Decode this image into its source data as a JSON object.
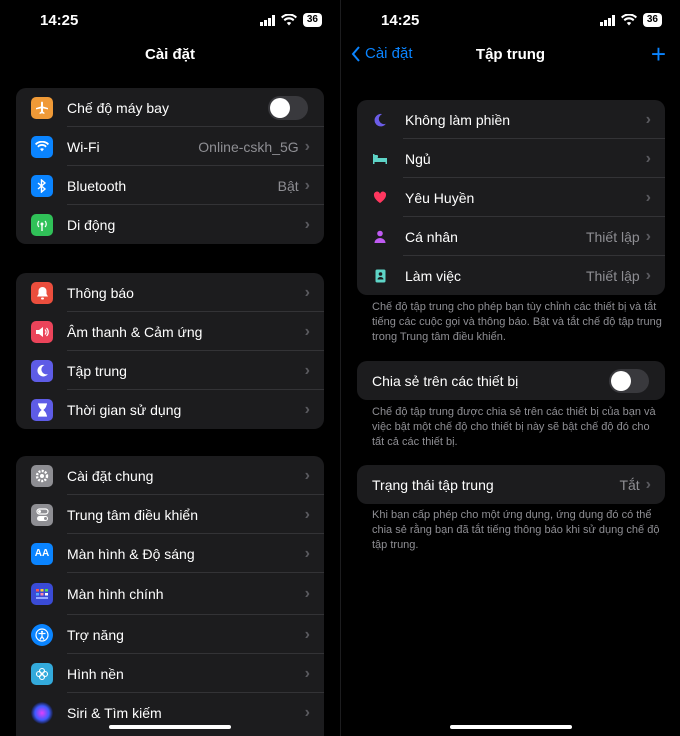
{
  "left": {
    "status": {
      "time": "14:25",
      "battery": "36"
    },
    "title": "Cài đặt",
    "group1": [
      {
        "label": "Chế độ máy bay",
        "toggle": false,
        "color": "#f09a37"
      },
      {
        "label": "Wi-Fi",
        "value": "Online-cskh_5G",
        "color": "#0a84ff"
      },
      {
        "label": "Bluetooth",
        "value": "Bật",
        "color": "#0a84ff"
      },
      {
        "label": "Di động",
        "color": "#30c158"
      }
    ],
    "group2": [
      {
        "label": "Thông báo",
        "color": "#eb4e3d"
      },
      {
        "label": "Âm thanh & Cảm ứng",
        "color": "#eb445a"
      },
      {
        "label": "Tập trung",
        "color": "#5e5ce6"
      },
      {
        "label": "Thời gian sử dụng",
        "color": "#5e5ce6"
      }
    ],
    "group3": [
      {
        "label": "Cài đặt chung",
        "color": "#8e8e93"
      },
      {
        "label": "Trung tâm điều khiển",
        "color": "#8e8e93"
      },
      {
        "label": "Màn hình & Độ sáng",
        "color": "#0a84ff"
      },
      {
        "label": "Màn hình chính",
        "color": "#3a4bd6"
      },
      {
        "label": "Trợ năng",
        "color": "#0a84ff"
      },
      {
        "label": "Hình nền",
        "color": "#33aadb"
      },
      {
        "label": "Siri & Tìm kiếm",
        "color": "#222"
      }
    ]
  },
  "right": {
    "status": {
      "time": "14:25",
      "battery": "36"
    },
    "back_label": "Cài đặt",
    "title": "Tập trung",
    "focus": [
      {
        "label": "Không làm phiền",
        "icon": "moon-icon",
        "color": "#6b5ce7"
      },
      {
        "label": "Ngủ",
        "icon": "bed-icon",
        "color": "#5ed4c7"
      },
      {
        "label": "Yêu Huyền",
        "icon": "heart-icon",
        "color": "#ff375f"
      },
      {
        "label": "Cá nhân",
        "value": "Thiết lập",
        "icon": "person-icon",
        "color": "#bf5af2"
      },
      {
        "label": "Làm việc",
        "value": "Thiết lập",
        "icon": "badge-icon",
        "color": "#5ed4c7"
      }
    ],
    "focus_note": "Chế độ tập trung cho phép bạn tùy chỉnh các thiết bị và tắt tiếng các cuộc gọi và thông báo. Bật và tắt chế độ tập trung trong Trung tâm điều khiển.",
    "share": {
      "label": "Chia sẻ trên các thiết bị",
      "toggle": false
    },
    "share_note": "Chế độ tập trung được chia sẻ trên các thiết bị của bạn và việc bật một chế độ cho thiết bị này sẽ bật chế độ đó cho tất cả các thiết bị.",
    "status_row": {
      "label": "Trạng thái tập trung",
      "value": "Tắt"
    },
    "status_note": "Khi bạn cấp phép cho một ứng dụng, ứng dụng đó có thể chia sẻ rằng bạn đã tắt tiếng thông báo khi sử dụng chế độ tập trung."
  }
}
